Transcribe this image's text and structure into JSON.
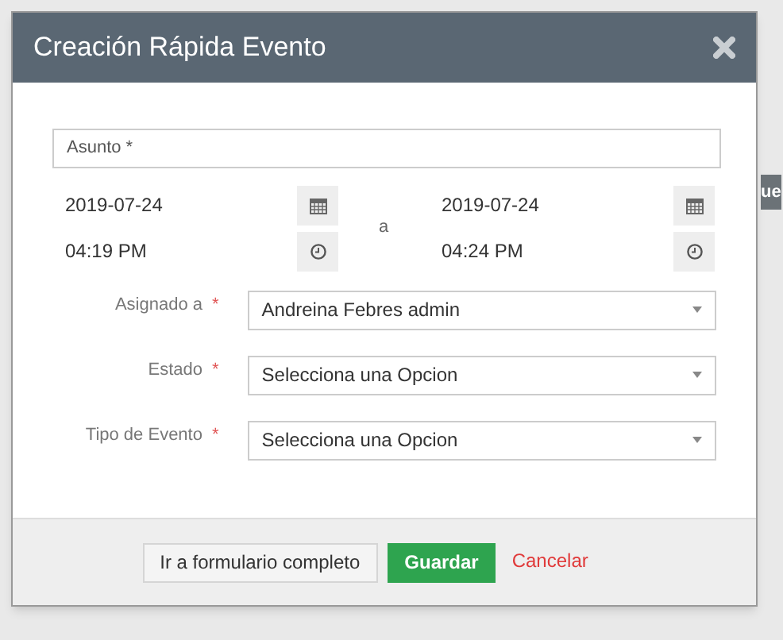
{
  "background": {
    "header_fragment": "ue"
  },
  "modal": {
    "title": "Creación Rápida Evento",
    "subject": {
      "placeholder": "Asunto *"
    },
    "start": {
      "date": "2019-07-24",
      "time": "04:19 PM"
    },
    "separator": "a",
    "end": {
      "date": "2019-07-24",
      "time": "04:24 PM"
    },
    "fields": [
      {
        "label": "Asignado a",
        "required_mark": "*",
        "value": "Andreina Febres admin"
      },
      {
        "label": "Estado",
        "required_mark": "*",
        "value": "Selecciona una Opcion"
      },
      {
        "label": "Tipo de Evento",
        "required_mark": "*",
        "value": "Selecciona una Opcion"
      }
    ],
    "buttons": [
      {
        "label": "Ir a formulario completo",
        "kind": "default"
      },
      {
        "label": "Guardar",
        "kind": "primary"
      },
      {
        "label": "Cancelar",
        "kind": "link"
      }
    ]
  }
}
